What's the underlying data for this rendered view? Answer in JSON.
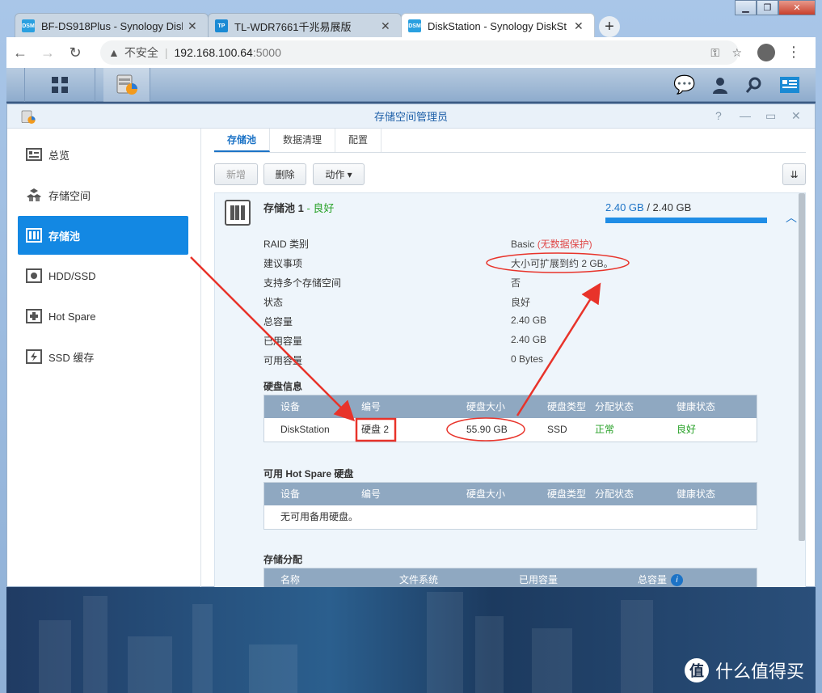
{
  "browser": {
    "tabs": [
      {
        "label": "BF-DS918Plus - Synology Disk",
        "favicon_text": "DSM",
        "favicon_color": "#2aa0e0"
      },
      {
        "label": "TL-WDR7661千兆易展版",
        "favicon_text": "TP",
        "favicon_color": "#1a8ad4"
      },
      {
        "label": "DiskStation - Synology DiskSt",
        "favicon_text": "DSM",
        "favicon_color": "#2aa0e0"
      }
    ],
    "insecure_label": "不安全",
    "url_host": "192.168.100.64",
    "url_port": ":5000"
  },
  "app": {
    "title": "存储空间管理员"
  },
  "sidebar": {
    "items": [
      {
        "label": "总览"
      },
      {
        "label": "存储空间"
      },
      {
        "label": "存储池"
      },
      {
        "label": "HDD/SSD"
      },
      {
        "label": "Hot Spare"
      },
      {
        "label": "SSD 缓存"
      }
    ]
  },
  "tabs": [
    "存储池",
    "数据清理",
    "配置"
  ],
  "toolbar": {
    "new": "新增",
    "delete": "删除",
    "action": "动作 ▾"
  },
  "pool": {
    "name": "存储池 1",
    "sep": " - ",
    "status": "良好",
    "used": "2.40 GB",
    "slash": " / ",
    "total": "2.40 GB",
    "usage_fraction": 1.0,
    "props": [
      {
        "k": "RAID 类别",
        "v": "Basic",
        "v_extra": "(无数据保护)"
      },
      {
        "k": "建议事项",
        "v": "大小可扩展到约 2 GB。"
      },
      {
        "k": "支持多个存储空间",
        "v": "否"
      },
      {
        "k": "状态",
        "v": "良好"
      },
      {
        "k": "总容量",
        "v": "2.40 GB"
      },
      {
        "k": "已用容量",
        "v": "2.40 GB"
      },
      {
        "k": "可用容量",
        "v": "0 Bytes"
      }
    ]
  },
  "disk_info": {
    "title": "硬盘信息",
    "headers": [
      "设备",
      "编号",
      "硬盘大小",
      "硬盘类型",
      "分配状态",
      "健康状态"
    ],
    "rows": [
      [
        "DiskStation",
        "硬盘 2",
        "55.90 GB",
        "SSD",
        "正常",
        "良好"
      ]
    ]
  },
  "hot_spare": {
    "title": "可用 Hot Spare 硬盘",
    "headers": [
      "设备",
      "编号",
      "硬盘大小",
      "硬盘类型",
      "分配状态",
      "健康状态"
    ],
    "empty": "无可用备用硬盘。"
  },
  "storage_alloc": {
    "title": "存储分配",
    "headers": [
      "名称",
      "文件系统",
      "已用容量",
      "总容量"
    ]
  },
  "watermark": {
    "glyph": "值",
    "text": "什么值得买"
  },
  "colors": {
    "accent": "#1388e3",
    "good": "#27a127",
    "warn": "#e04848",
    "annotation": "#e8332a"
  }
}
